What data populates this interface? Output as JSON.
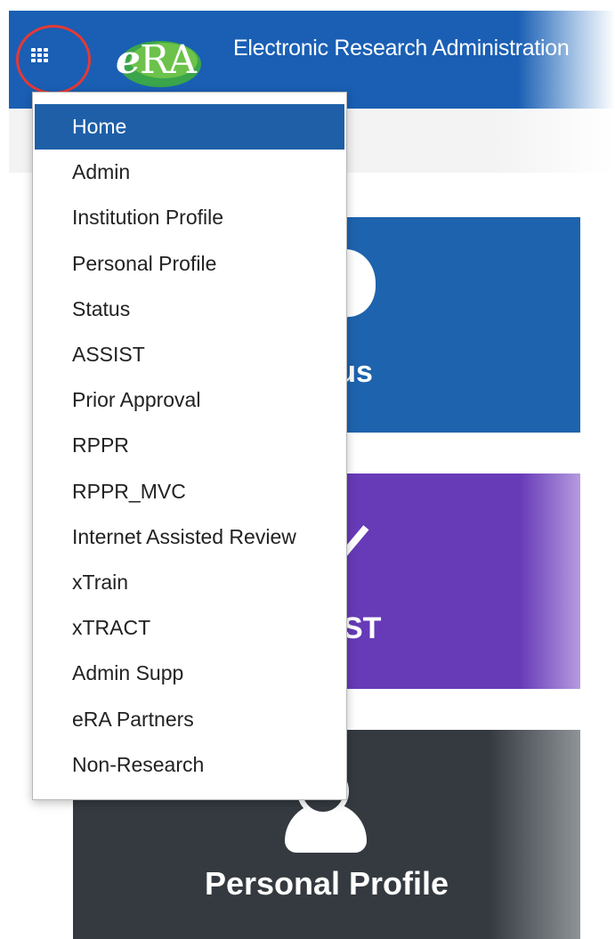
{
  "header": {
    "logo_text_e": "e",
    "logo_text_ra": "RA",
    "title": "Electronic Research Administration"
  },
  "tiles": [
    {
      "label": "Status",
      "icon": "lightbulb-icon",
      "color": "#1e63ad"
    },
    {
      "label": "ASSIST",
      "icon": "checkmark-icon",
      "color": "#673ab7"
    },
    {
      "label": "Personal Profile",
      "icon": "person-icon",
      "color": "#343a40"
    }
  ],
  "menu": {
    "active_index": 0,
    "items": [
      "Home",
      "Admin",
      "Institution Profile",
      "Personal Profile",
      "Status",
      "ASSIST",
      "Prior Approval",
      "RPPR",
      "RPPR_MVC",
      "Internet Assisted Review",
      "xTrain",
      "xTRACT",
      "Admin Supp",
      "eRA Partners",
      "Non-Research"
    ]
  },
  "colors": {
    "header_blue": "#1a5fb4",
    "menu_active": "#1e5fa8",
    "highlight_ring": "#e53935"
  }
}
